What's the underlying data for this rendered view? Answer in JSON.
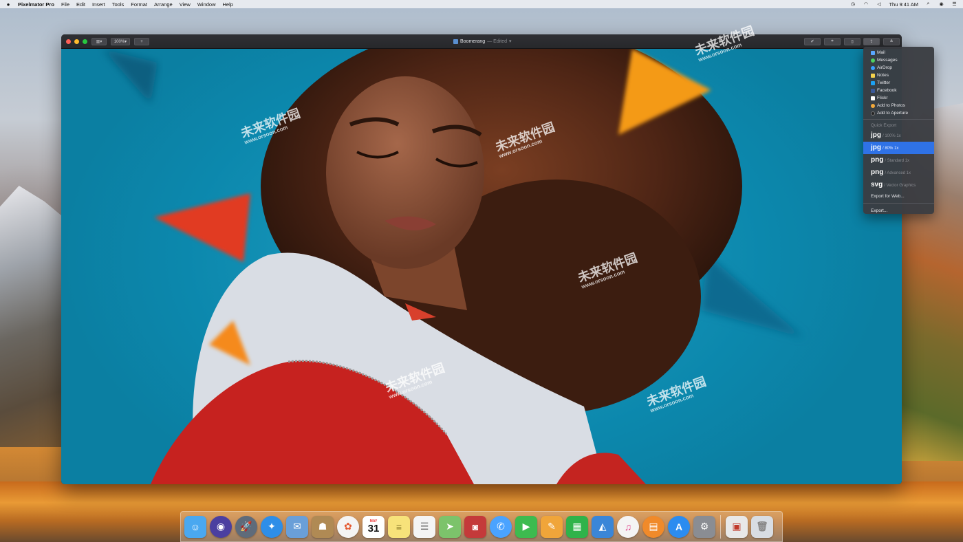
{
  "menubar": {
    "app_name": "Pixelmator Pro",
    "items": [
      "File",
      "Edit",
      "Insert",
      "Tools",
      "Format",
      "Arrange",
      "View",
      "Window",
      "Help"
    ],
    "clock": "Thu 9:41 AM",
    "status_icons": [
      "time-machine-icon",
      "wifi-icon",
      "volume-icon",
      "search-icon",
      "user-icon",
      "notification-center-icon"
    ]
  },
  "window": {
    "zoom_level": "100%",
    "add_label": "+",
    "document_title": "Boomerang",
    "document_status": "— Edited",
    "toolbar_icons": [
      "paint-tool-icon",
      "crop-icon",
      "document-icon",
      "share-icon",
      "adjust-icon"
    ]
  },
  "share_menu": {
    "services": [
      {
        "label": "Mail",
        "icon": "mail-icon",
        "color": "#5aa7ff"
      },
      {
        "label": "Messages",
        "icon": "messages-icon",
        "color": "#4fd15f"
      },
      {
        "label": "AirDrop",
        "icon": "airdrop-icon",
        "color": "#3aa0ff"
      },
      {
        "label": "Notes",
        "icon": "notes-icon",
        "color": "#f5d24c"
      },
      {
        "label": "Twitter",
        "icon": "twitter-icon",
        "color": "#1da1f2"
      },
      {
        "label": "Facebook",
        "icon": "facebook-icon",
        "color": "#3b5998"
      },
      {
        "label": "Flickr",
        "icon": "flickr-icon",
        "color": "#ffffff"
      },
      {
        "label": "Add to Photos",
        "icon": "photos-icon",
        "color": "#f2a93b"
      },
      {
        "label": "Add to Aperture",
        "icon": "aperture-icon",
        "color": "#222222"
      }
    ],
    "quick_export_heading": "Quick Export",
    "quick_exports": [
      {
        "format": "jpg",
        "option": "/ 100% 1x",
        "selected": false
      },
      {
        "format": "jpg",
        "option": "/ 80% 1x",
        "selected": true
      },
      {
        "format": "png",
        "option": "/ Standard 1x",
        "selected": false
      },
      {
        "format": "png",
        "option": "/ Advanced 1x",
        "selected": false
      },
      {
        "format": "svg",
        "option": "/ Vector Graphics",
        "selected": false
      }
    ],
    "export_for_web": "Export for Web...",
    "export": "Export..."
  },
  "watermark": {
    "brand": "未来软件园",
    "url": "www.orsoon.com"
  },
  "dock": {
    "apps": [
      {
        "name": "finder",
        "glyph": "☺",
        "color": "#4aa8f0"
      },
      {
        "name": "siri",
        "glyph": "◉",
        "color": "#4b3fa0"
      },
      {
        "name": "launchpad",
        "glyph": "🚀",
        "color": "#5f6b7a"
      },
      {
        "name": "safari",
        "glyph": "✦",
        "color": "#2e8ee8"
      },
      {
        "name": "mail",
        "glyph": "✉",
        "color": "#6a9fd8"
      },
      {
        "name": "contacts",
        "glyph": "☗",
        "color": "#b08a54"
      },
      {
        "name": "photos",
        "glyph": "✿",
        "color": "#f4f4f4"
      },
      {
        "name": "calendar",
        "glyph": "31",
        "color": "#ffffff"
      },
      {
        "name": "notes",
        "glyph": "≡",
        "color": "#f7e27a"
      },
      {
        "name": "reminders",
        "glyph": "☰",
        "color": "#f4f4f4"
      },
      {
        "name": "maps",
        "glyph": "➤",
        "color": "#7cc36b"
      },
      {
        "name": "photo-booth",
        "glyph": "◙",
        "color": "#c43a3a"
      },
      {
        "name": "messages",
        "glyph": "✆",
        "color": "#4aa3ff"
      },
      {
        "name": "facetime",
        "glyph": "▶",
        "color": "#3dbb4f"
      },
      {
        "name": "pages",
        "glyph": "✎",
        "color": "#f0a53a"
      },
      {
        "name": "numbers",
        "glyph": "▦",
        "color": "#2fb34a"
      },
      {
        "name": "keynote",
        "glyph": "◭",
        "color": "#3a86d8"
      },
      {
        "name": "itunes",
        "glyph": "♫",
        "color": "#f4f4f4"
      },
      {
        "name": "ibooks",
        "glyph": "▤",
        "color": "#f08a2a"
      },
      {
        "name": "app-store",
        "glyph": "A",
        "color": "#2b8cf0"
      },
      {
        "name": "system-preferences",
        "glyph": "⚙",
        "color": "#8a8d93"
      },
      {
        "name": "pixelmator-pro",
        "glyph": "▣",
        "color": "#e8e8e8"
      },
      {
        "name": "trash",
        "glyph": "🗑",
        "color": "#d8dde3"
      }
    ],
    "calendar_month": "MAY",
    "calendar_day": "31"
  }
}
